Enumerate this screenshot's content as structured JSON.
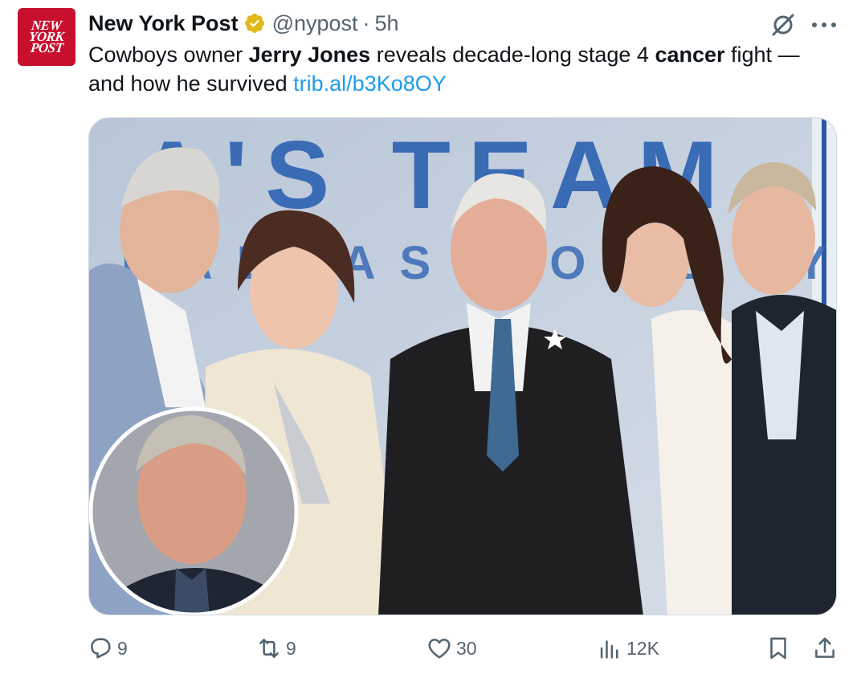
{
  "account": {
    "avatar_lines": [
      "NEW",
      "YORK",
      "POST"
    ],
    "name": "New York Post",
    "handle": "@nypost",
    "separator": "·",
    "time": "5h",
    "verified_badge": "gold-verified-badge"
  },
  "post": {
    "text_1": "Cowboys owner ",
    "bold_1": "Jerry Jones",
    "text_2": " reveals decade-long stage 4 ",
    "bold_2": "cancer",
    "text_3": " fight — and how he survived ",
    "link": "trib.al/b3Ko8OY"
  },
  "media": {
    "backdrop_text_top": "A'S TEAM",
    "backdrop_text_bottom": "DALLAS COWBOYS"
  },
  "actions": {
    "replies": "9",
    "reposts": "9",
    "likes": "30",
    "views": "12K"
  },
  "colors": {
    "accent_link": "#1d9bf0",
    "secondary_text": "#536471",
    "brand_red": "#c8102e",
    "verified_gold": "#e2b719"
  }
}
